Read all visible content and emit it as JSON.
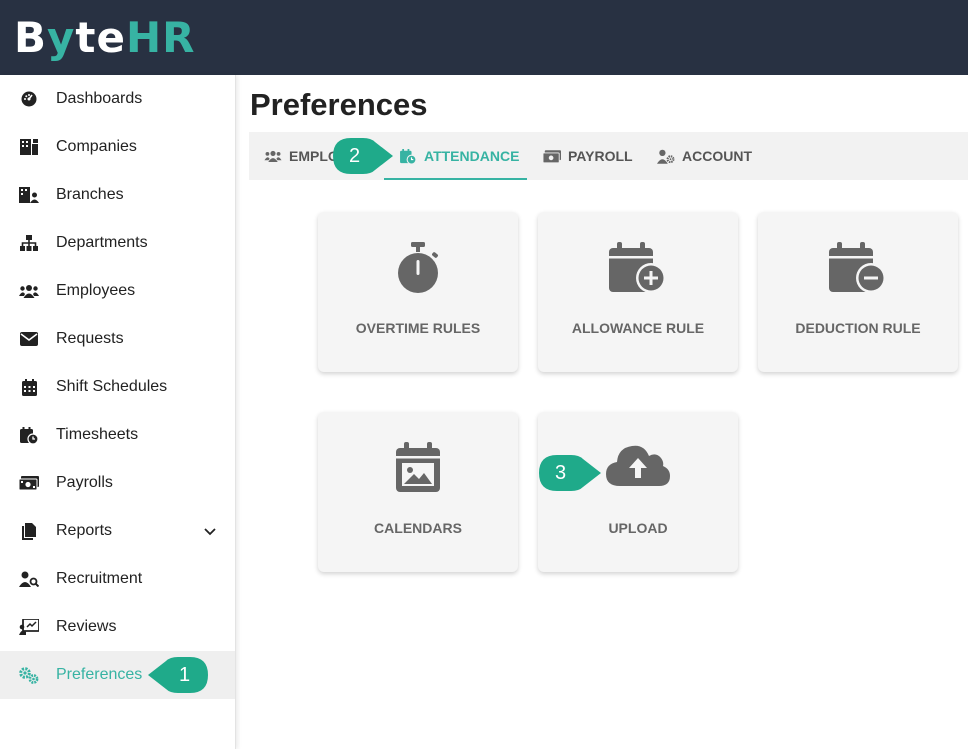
{
  "app": {
    "logo_parts": [
      "B",
      "y",
      "te",
      "HR"
    ],
    "accent_color": "#37b3a3",
    "topbar_color": "#283142"
  },
  "sidebar": {
    "items": [
      {
        "label": "Dashboards",
        "icon": "dashboard-icon"
      },
      {
        "label": "Companies",
        "icon": "building-icon"
      },
      {
        "label": "Branches",
        "icon": "branch-building-icon"
      },
      {
        "label": "Departments",
        "icon": "sitemap-icon"
      },
      {
        "label": "Employees",
        "icon": "users-icon"
      },
      {
        "label": "Requests",
        "icon": "envelope-icon"
      },
      {
        "label": "Shift Schedules",
        "icon": "calendar-icon"
      },
      {
        "label": "Timesheets",
        "icon": "calendar-clock-icon"
      },
      {
        "label": "Payrolls",
        "icon": "money-bill-icon"
      },
      {
        "label": "Reports",
        "icon": "file-icon",
        "has_submenu": true
      },
      {
        "label": "Recruitment",
        "icon": "user-search-icon"
      },
      {
        "label": "Reviews",
        "icon": "chalkboard-icon"
      },
      {
        "label": "Preferences",
        "icon": "gears-icon",
        "active": true
      }
    ]
  },
  "page": {
    "title": "Preferences",
    "tabs": [
      {
        "label": "EMPLOYEE",
        "visible_label": "EMPLO",
        "icon": "users-icon"
      },
      {
        "label": "ATTENDANCE",
        "icon": "calendar-clock-icon",
        "active": true
      },
      {
        "label": "PAYROLL",
        "icon": "money-bill-icon"
      },
      {
        "label": "ACCOUNT",
        "icon": "user-gear-icon"
      }
    ],
    "cards": [
      {
        "label": "OVERTIME RULES",
        "icon": "stopwatch-icon"
      },
      {
        "label": "ALLOWANCE RULE",
        "icon": "calendar-plus-icon"
      },
      {
        "label": "DEDUCTION RULE",
        "icon": "calendar-minus-icon"
      },
      {
        "label": "CALENDARS",
        "icon": "calendar-image-icon"
      },
      {
        "label": "UPLOAD",
        "icon": "cloud-upload-icon"
      }
    ]
  },
  "callouts": [
    "1",
    "2",
    "3"
  ]
}
